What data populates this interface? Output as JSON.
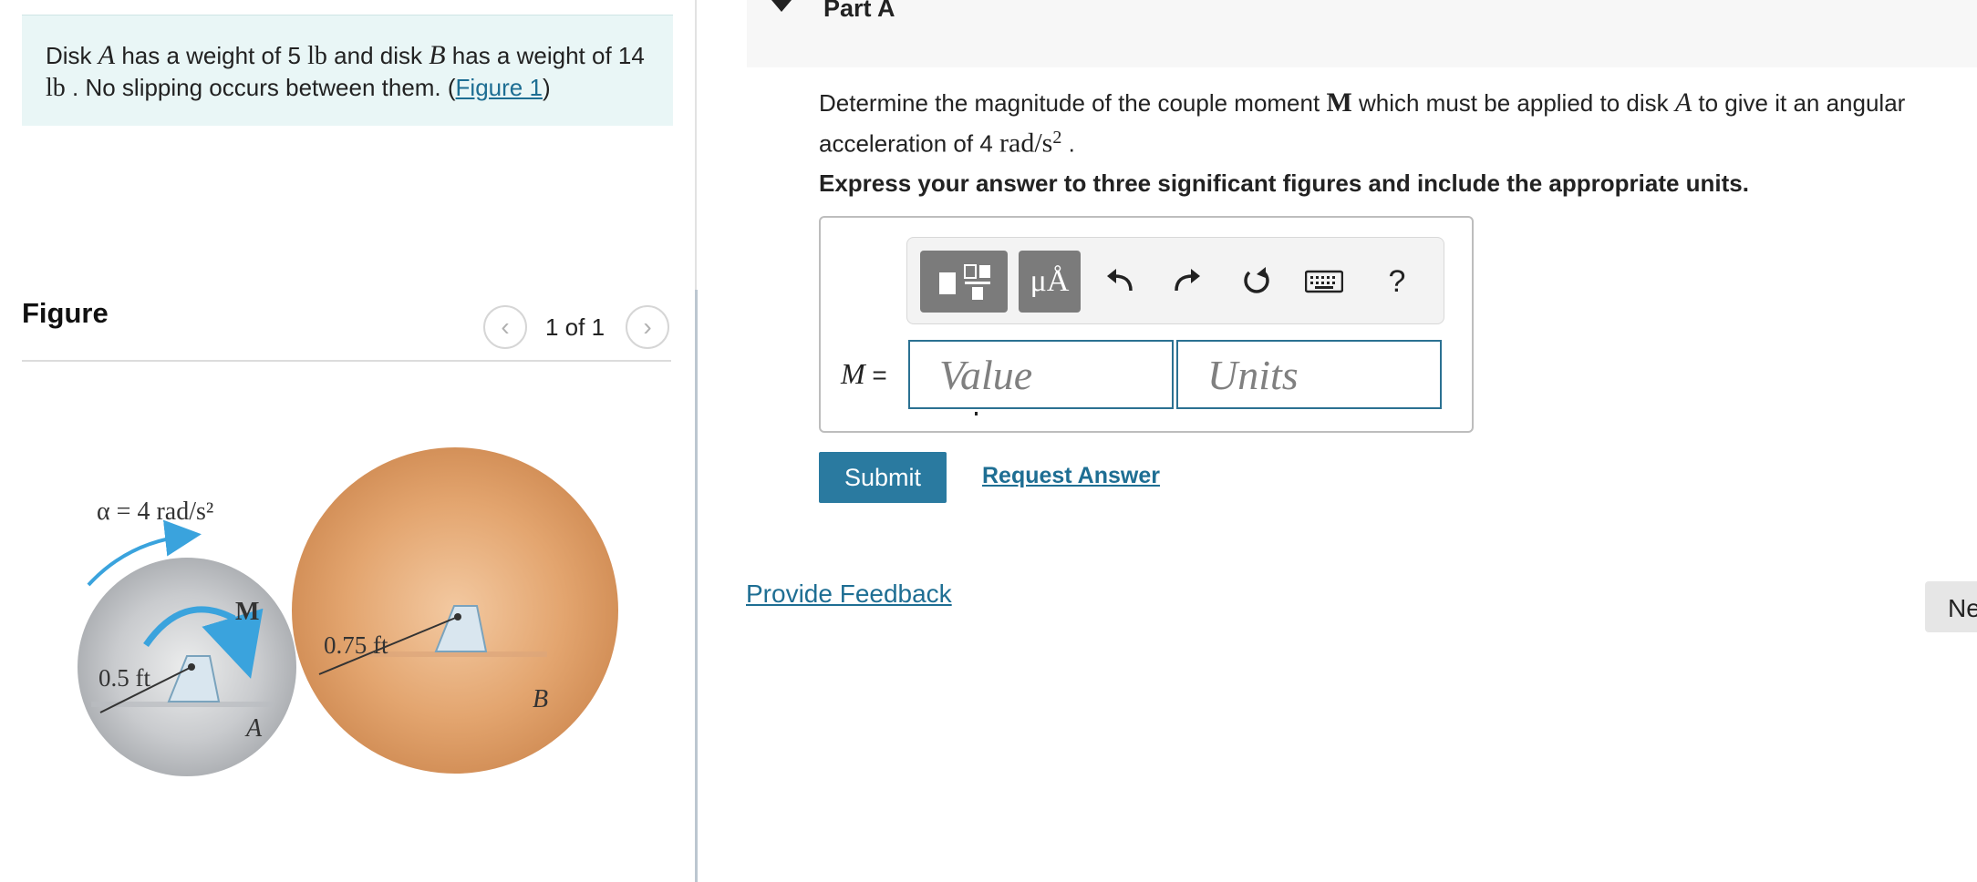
{
  "problem": {
    "seg1": "Disk ",
    "diskA": "A",
    "seg2": " has a weight of 5 ",
    "unit1": "lb",
    "seg3": " and disk ",
    "diskB": "B",
    "seg4": " has a weight of 14 ",
    "unit2": "lb",
    "seg5": " . No slipping occurs between them. (",
    "figure_link": "Figure 1",
    "seg6": ")"
  },
  "figure": {
    "heading": "Figure",
    "counter": "1 of 1",
    "prev_icon": "chevron-left-icon",
    "next_icon": "chevron-right-icon",
    "labels": {
      "alpha": "α = 4 rad/s²",
      "moment": "M",
      "radius_a": "0.5 ft",
      "radius_b": "0.75 ft",
      "disk_a": "A",
      "disk_b": "B"
    },
    "colors": {
      "disk_a": "#c7c9cc",
      "disk_b": "#e2a36c",
      "arrow": "#3aa3dd"
    }
  },
  "part": {
    "title": "Part A",
    "question": {
      "seg1": "Determine the magnitude of the couple moment ",
      "moment": "M",
      "seg2": " which must be applied to disk ",
      "disk": "A",
      "seg3": " to give it an angular acceleration of 4 ",
      "unit": "rad/s",
      "exp": "2",
      "seg4": " ."
    },
    "instruction": "Express your answer to three significant figures and include the appropriate units."
  },
  "answer": {
    "variable": "M",
    "equals": " =",
    "value_placeholder": "Value",
    "units_placeholder": "Units",
    "toolbar": {
      "templates_icon": "templates-icon",
      "units_label": "μÅ",
      "undo_icon": "undo-icon",
      "redo_icon": "redo-icon",
      "reset_icon": "reset-icon",
      "keyboard_icon": "keyboard-icon",
      "help_label": "?"
    }
  },
  "buttons": {
    "submit": "Submit",
    "request_answer": "Request Answer",
    "provide_feedback": "Provide Feedback",
    "next": "Ne"
  }
}
